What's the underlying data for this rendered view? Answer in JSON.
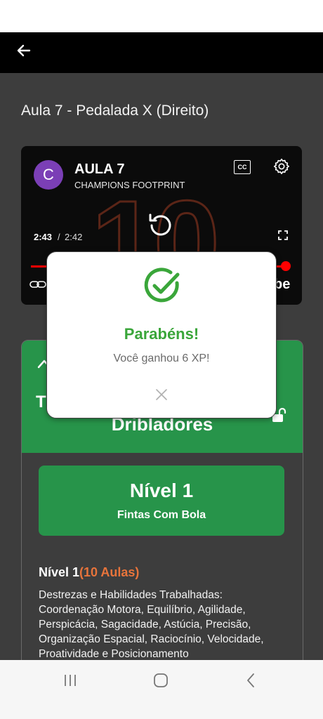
{
  "page": {
    "title": "Aula 7 - Pedalada X (Direito)"
  },
  "video": {
    "avatar_letter": "C",
    "title": "AULA 7",
    "channel": "CHAMPIONS FOOTPRINT",
    "cc_label": "CC",
    "time_current": "2:43",
    "time_separator": "/",
    "time_total": "2:42",
    "bg_number": "10",
    "logo_fragment": "be",
    "progress": 1.0
  },
  "card": {
    "header_letter": "T",
    "header_title": "Dribladores",
    "level": {
      "title": "Nível 1",
      "subtitle": "Fintas Com Bola"
    },
    "level_heading_main": "Nível 1",
    "level_heading_count": "(10 Aulas)",
    "skills_text": "Destrezas e Habilidades Trabalhadas: Coordenação Motora, Equilíbrio, Agilidade, Perspicácia, Sagacidade, Astúcia, Precisão, Organização Espacial, Raciocínio, Velocidade, Proatividade e Posicionamento"
  },
  "dialog": {
    "title": "Parabéns!",
    "message": "Você ganhou 6 XP!"
  },
  "icons": {
    "back": "back-arrow-icon",
    "settings": "gear-icon",
    "replay": "replay-icon",
    "fullscreen": "fullscreen-icon",
    "lock": "unlock-icon",
    "check": "check-circle-icon",
    "close": "close-icon"
  },
  "colors": {
    "accent_green": "#27944a",
    "success_green": "#3aa63a",
    "highlight_orange": "#e8743b",
    "progress_red": "#ff0000",
    "avatar_purple": "#7b3fb6"
  }
}
